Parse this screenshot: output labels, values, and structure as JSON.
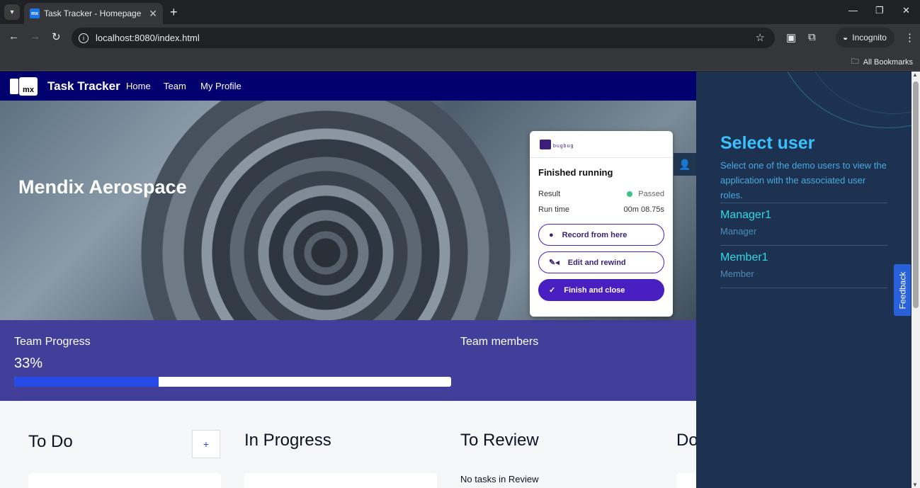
{
  "browser": {
    "tab_title": "Task Tracker - Homepage",
    "tab_favicon": "mx",
    "url": "localhost:8080/index.html",
    "incognito_label": "Incognito",
    "bookmarks_label": "All Bookmarks"
  },
  "app": {
    "logo_text": "mx",
    "title": "Task Tracker",
    "nav": [
      "Home",
      "Team",
      "My Profile"
    ],
    "hero_title": "Mendix Aerospace",
    "team_progress_label": "Team Progress",
    "team_progress_value": "33%",
    "team_progress_fraction": 0.33,
    "team_members_label": "Team members",
    "lanes": {
      "todo": "To Do",
      "in_progress": "In Progress",
      "to_review": "To Review",
      "done_partial": "Do"
    },
    "add_button": "+",
    "no_review_tasks": "No tasks in Review"
  },
  "bugbug": {
    "brand": "bugbug",
    "title": "Finished running",
    "result_label": "Result",
    "result_value": "Passed",
    "runtime_label": "Run time",
    "runtime_value": "00m 08.75s",
    "record_label": "Record from here",
    "edit_label": "Edit and rewind",
    "finish_label": "Finish and close",
    "status_color": "#3cc488",
    "accent_color": "#4a1fc2"
  },
  "user_panel": {
    "title": "Select user",
    "description": "Select one of the demo users to view the application with the associated user roles.",
    "users": [
      {
        "name": "Manager1",
        "role": "Manager"
      },
      {
        "name": "Member1",
        "role": "Member"
      }
    ],
    "feedback_label": "Feedback"
  }
}
